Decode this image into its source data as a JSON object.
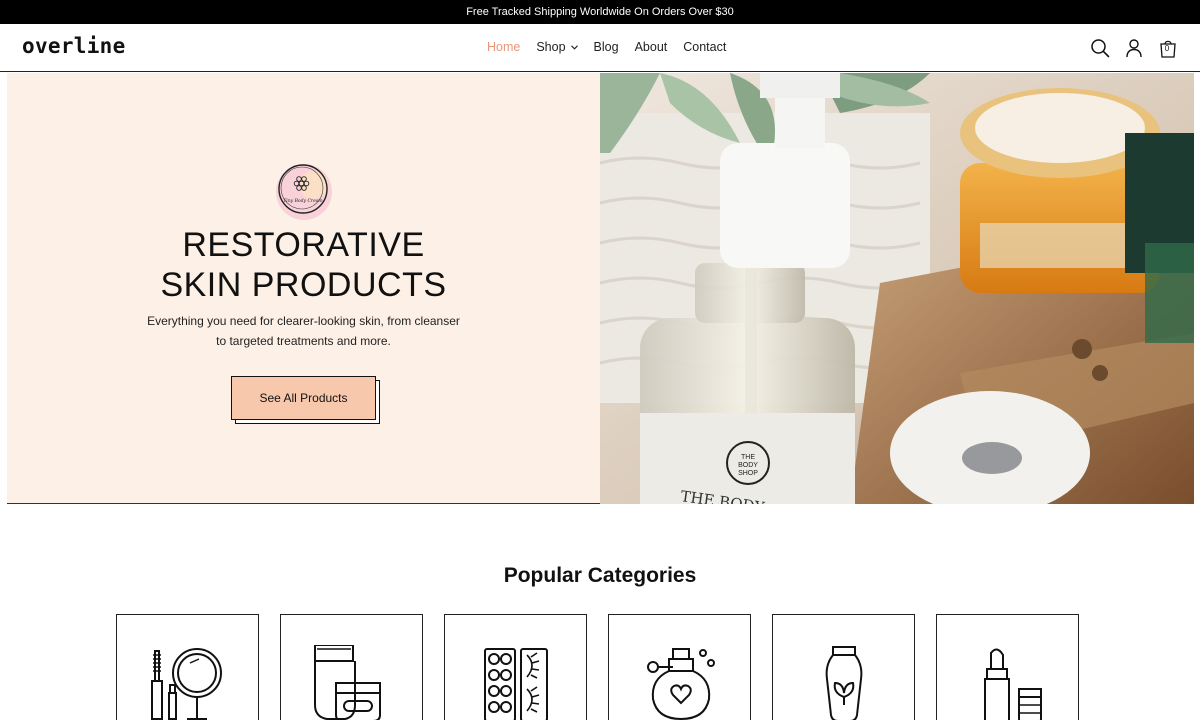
{
  "announcement": "Free Tracked Shipping Worldwide On Orders Over $30",
  "brand": {
    "logo": "overline"
  },
  "nav": {
    "items": [
      {
        "label": "Home",
        "active": true
      },
      {
        "label": "Shop",
        "has_dropdown": true
      },
      {
        "label": "Blog"
      },
      {
        "label": "About"
      },
      {
        "label": "Contact"
      }
    ]
  },
  "header_icons": [
    "search-icon",
    "account-icon",
    "cart-icon"
  ],
  "cart": {
    "count": "0"
  },
  "hero": {
    "badge_text": "Tiny Body Cream",
    "title_line1": "RESTORATIVE",
    "title_line2": "SKIN PRODUCTS",
    "subtitle_line1": "Everything you need for clearer-looking skin, from cleanser",
    "subtitle_line2": "to targeted treatments and more.",
    "cta_label": "See All Products",
    "image_label_line1": "THE",
    "image_label_line2": "BODY",
    "image_label_line3": "SHOP",
    "image_bottle_text": "THE BODY"
  },
  "categories": {
    "title": "Popular Categories",
    "icons": [
      "mirror-mascara-icon",
      "cream-tubes-icon",
      "palette-lashes-icon",
      "perfume-icon",
      "lotion-bottle-icon",
      "lipstick-icon"
    ]
  },
  "colors": {
    "accent": "#e8967a",
    "hero_bg": "#fdf0e6",
    "button_bg": "#f7c8ac",
    "announcement_bg": "#000000"
  }
}
